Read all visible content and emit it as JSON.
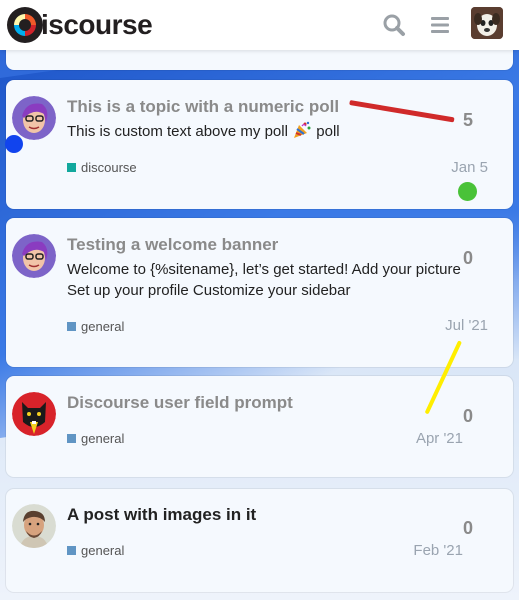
{
  "header": {
    "logo_text": "iscourse",
    "logo_icon": "discourse-logo-icon",
    "search_icon": "search-icon",
    "menu_icon": "hamburger-menu-icon",
    "user_avatar": "user-avatar"
  },
  "topics": [
    {
      "title": "This is a topic with a numeric poll",
      "excerpt_before": "This is custom text above my poll",
      "excerpt_emoji": "party-popper-icon",
      "excerpt_after": "poll",
      "category": "discourse",
      "category_color": "#12a89d",
      "replies": "5",
      "date": "Jan 5"
    },
    {
      "title": "Testing a welcome banner",
      "excerpt": "Welcome to {%sitename}, let’s get started! Add your picture Set up your profile Customize your sidebar",
      "category": "general",
      "category_color": "#6095c4",
      "replies": "0",
      "date": "Jul '21"
    },
    {
      "title": "Discourse user field prompt",
      "category": "general",
      "category_color": "#6095c4",
      "replies": "0",
      "date": "Apr '21"
    },
    {
      "title": "A post with images in it",
      "category": "general",
      "category_color": "#6095c4",
      "replies": "0",
      "date": "Feb '21"
    }
  ],
  "colors": {
    "unread_dot": "#49c238",
    "annotation_red": "#d02a2a",
    "annotation_yellow": "#ffee00",
    "annotation_blue_dot": "#1144ee"
  }
}
